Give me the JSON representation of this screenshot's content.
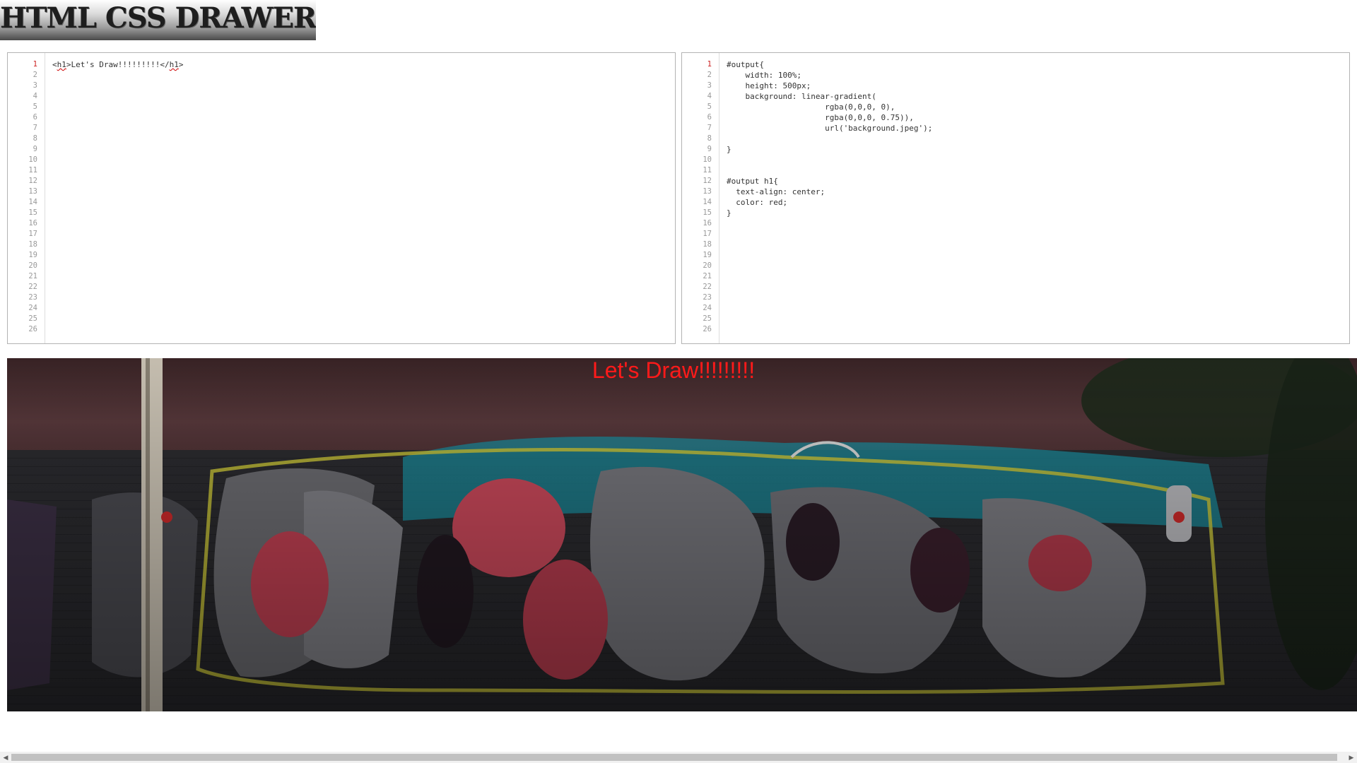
{
  "app": {
    "title": "HTML CSS DRAWER"
  },
  "html_editor": {
    "line_numbers": [
      "1",
      "2",
      "3",
      "4",
      "5",
      "6",
      "7",
      "8",
      "9",
      "10",
      "11",
      "12",
      "13",
      "14",
      "15",
      "16",
      "17",
      "18",
      "19",
      "20",
      "21",
      "22",
      "23",
      "24",
      "25",
      "26"
    ],
    "active_line": "1",
    "code_pre": "<",
    "code_tag_open": "h1",
    "code_mid": ">Let's Draw!!!!!!!!!</",
    "code_tag_close": "h1",
    "code_post": ">"
  },
  "css_editor": {
    "line_numbers": [
      "1",
      "2",
      "3",
      "4",
      "5",
      "6",
      "7",
      "8",
      "9",
      "10",
      "11",
      "12",
      "13",
      "14",
      "15",
      "16",
      "17",
      "18",
      "19",
      "20",
      "21",
      "22",
      "23",
      "24",
      "25",
      "26"
    ],
    "active_line": "1",
    "lines": [
      "#output{",
      "    width: 100%;",
      "    height: 500px;",
      "    background: linear-gradient(",
      "                     rgba(0,0,0, 0),",
      "                     rgba(0,0,0, 0.75)),",
      "                     url('background.jpeg');",
      "",
      "}",
      "",
      "",
      "#output h1{",
      "  text-align: center;",
      "  color: red;",
      "}"
    ]
  },
  "output": {
    "heading": "Let's Draw!!!!!!!!!",
    "heading_color": "#ff1a1a"
  },
  "scrollbar": {
    "left_arrow": "◀",
    "right_arrow": "▶"
  }
}
